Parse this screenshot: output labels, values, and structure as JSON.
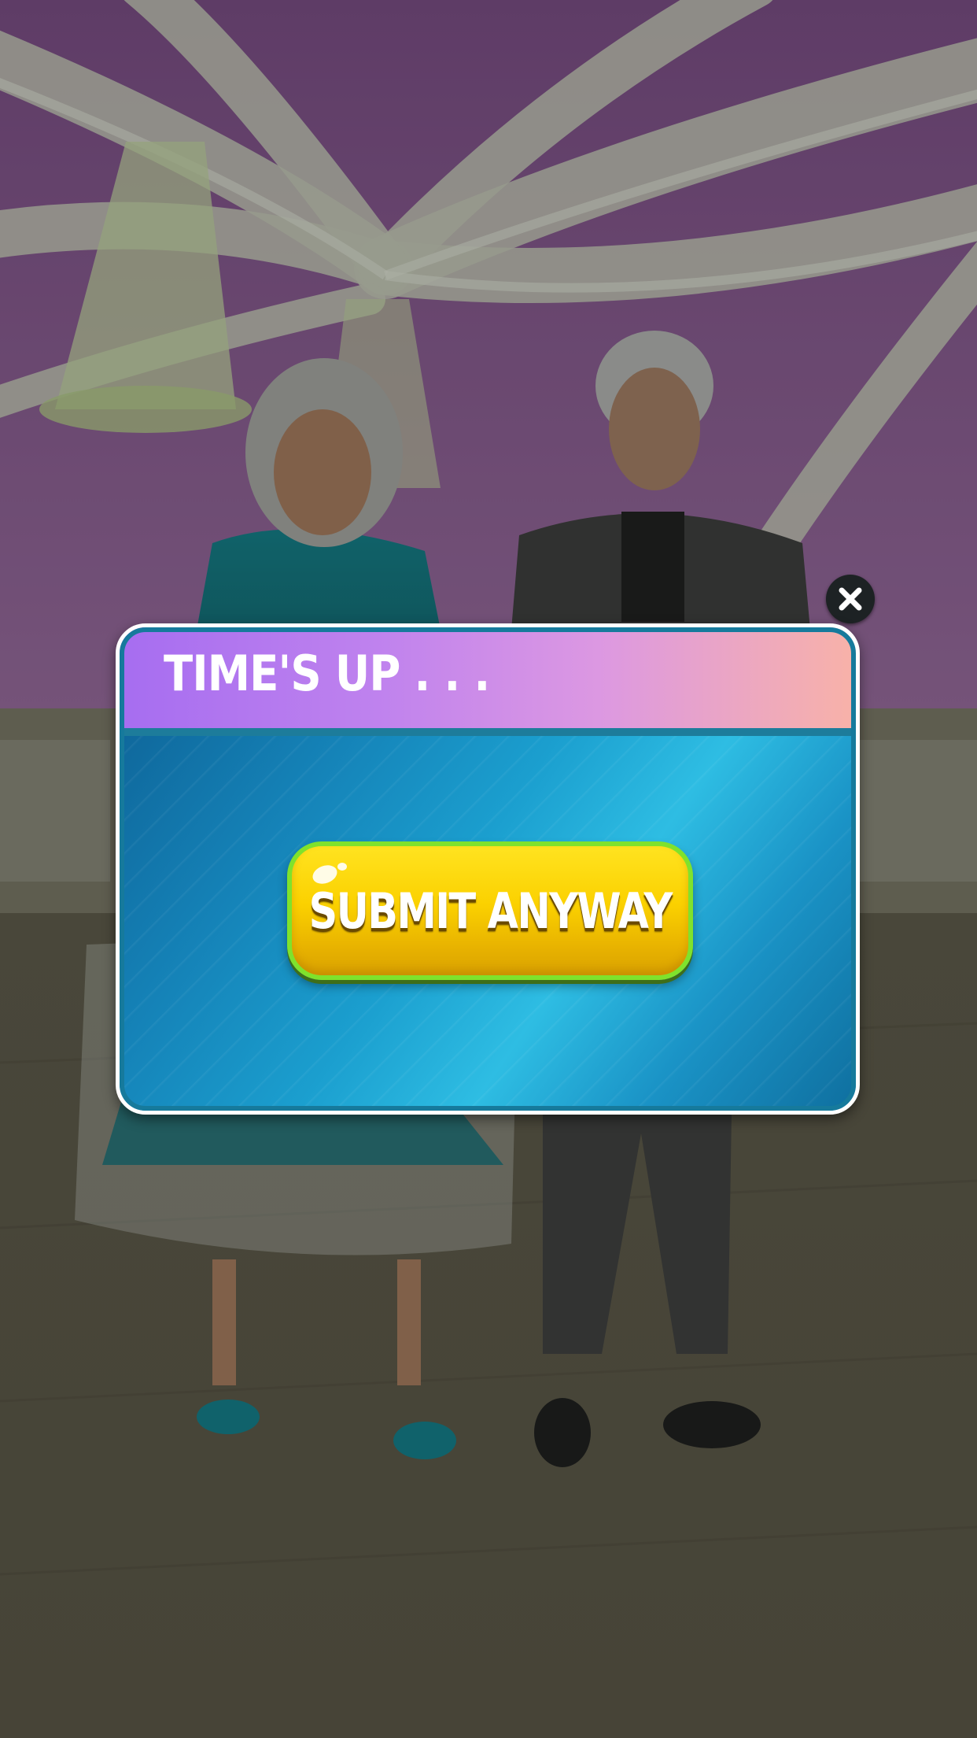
{
  "dialog": {
    "title": "TIME'S UP . . .",
    "submit_label": "SUBMIT ANYWAY"
  },
  "close_button": {
    "icon": "close-icon"
  },
  "colors": {
    "header_gradient_start": "#a66df0",
    "header_gradient_end": "#f8b2a8",
    "dialog_body": "#1b9fcf",
    "button_yellow": "#fbd100",
    "button_border_green": "#7fe22c"
  },
  "scene": {
    "description_icons": [
      "chandelier-icon",
      "bride-character",
      "groom-character"
    ]
  }
}
